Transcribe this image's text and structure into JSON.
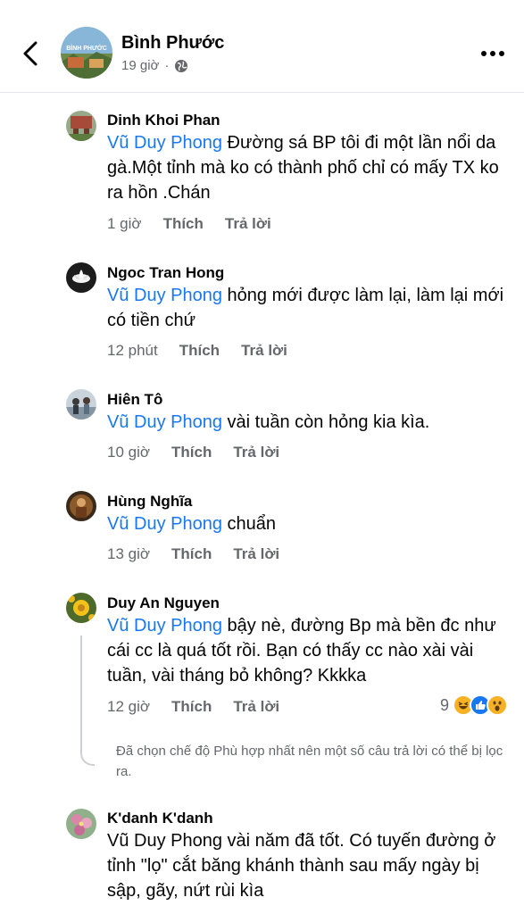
{
  "header": {
    "group_name": "Bình Phước",
    "time": "19 giờ",
    "separator": "·",
    "avatar_text": "BÌNH PHƯỚC"
  },
  "comments": [
    {
      "author": "Dinh Khoi Phan",
      "mention": "Vũ Duy Phong",
      "text": " Đường sá BP tôi đi một lần nổi da gà.Một tỉnh mà ko có thành phố chỉ có mấy TX ko ra hồn .Chán",
      "time": "1 giờ",
      "like": "Thích",
      "reply": "Trả lời"
    },
    {
      "author": "Ngoc Tran Hong",
      "mention": "Vũ Duy Phong",
      "text": " hỏng mới được làm lại, làm lại mới có tiền chứ",
      "time": "12 phút",
      "like": "Thích",
      "reply": "Trả lời"
    },
    {
      "author": "Hiên Tô",
      "mention": "Vũ Duy Phong",
      "text": " vài tuần còn hỏng kia kìa.",
      "time": "10 giờ",
      "like": "Thích",
      "reply": "Trả lời"
    },
    {
      "author": "Hùng Nghĩa",
      "mention": "Vũ Duy Phong",
      "text": " chuẩn",
      "time": "13 giờ",
      "like": "Thích",
      "reply": "Trả lời"
    },
    {
      "author": "Duy An Nguyen",
      "mention": "Vũ Duy Phong",
      "text": " bậy nè, đường Bp mà bền đc như cái cc là quá tốt rồi. Bạn có thấy cc nào xài vài tuần, vài tháng bỏ không? Kkkka",
      "time": "12 giờ",
      "like": "Thích",
      "reply": "Trả lời",
      "reaction_count": "9"
    },
    {
      "author": "K'danh K'danh",
      "text": "Vũ Duy Phong vài năm đã tốt. Có tuyến đường ở tỉnh \"lọ\" cắt băng khánh thành sau mấy ngày bị sập, gãy, nứt rùi kìa"
    }
  ],
  "filter_note": "Đã chọn chế độ Phù hợp nhất nên một số câu trả lời có thể bị lọc ra.",
  "colors": {
    "accent": "#1877f2",
    "secondary_text": "#65676b",
    "primary_text": "#050505"
  }
}
